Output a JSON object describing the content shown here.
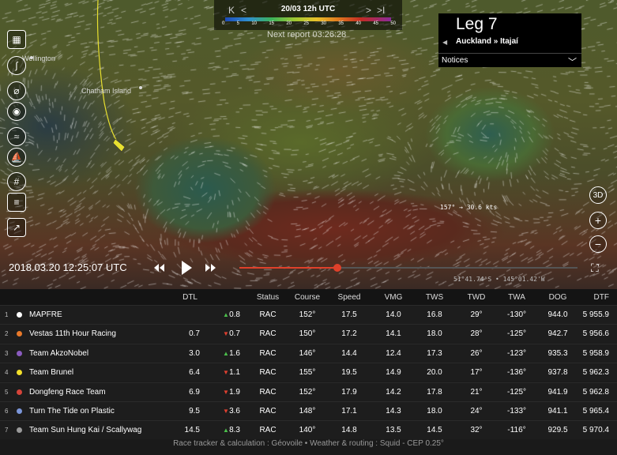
{
  "header": {
    "date": "20/03 12h UTC",
    "nav_first": "K",
    "nav_prev": "<",
    "nav_next": ">",
    "nav_last": ">I",
    "scale_labels": [
      "0",
      "5",
      "10",
      "15",
      "20",
      "25",
      "30",
      "35",
      "40",
      "45",
      "50"
    ],
    "next_report": "Next report 03:26:28"
  },
  "leg": {
    "title": "Leg 7",
    "route": "Auckland » Itajaí",
    "notices_label": "Notices"
  },
  "map": {
    "places": [
      "Wellington",
      "Chatham Island"
    ],
    "wind_readout": "157° → 30.6 kts",
    "coordinates": "51°41.74'S • 145°01.42'W",
    "boat_color": "#e8e030"
  },
  "playback": {
    "time": "2018.03.20 12:25:07 UTC",
    "progress": 0.29
  },
  "table": {
    "headers": [
      "DTL",
      "Status",
      "Course",
      "Speed",
      "VMG",
      "TWS",
      "TWD",
      "TWA",
      "DOG",
      "DTF"
    ],
    "rows": [
      {
        "rank": "1",
        "color": "#ffffff",
        "team": "MAPFRE",
        "dtl": "",
        "trend": "up",
        "change": "0.8",
        "status": "RAC",
        "course": "152°",
        "speed": "17.5",
        "vmg": "14.0",
        "tws": "16.8",
        "twd": "29°",
        "twa": "-130°",
        "dog": "944.0",
        "dtf": "5 955.9"
      },
      {
        "rank": "2",
        "color": "#e8792a",
        "team": "Vestas 11th Hour Racing",
        "dtl": "0.7",
        "trend": "down",
        "change": "0.7",
        "status": "RAC",
        "course": "150°",
        "speed": "17.2",
        "vmg": "14.1",
        "tws": "18.0",
        "twd": "28°",
        "twa": "-125°",
        "dog": "942.7",
        "dtf": "5 956.6"
      },
      {
        "rank": "3",
        "color": "#8a5bbf",
        "team": "Team AkzoNobel",
        "dtl": "3.0",
        "trend": "up",
        "change": "1.6",
        "status": "RAC",
        "course": "146°",
        "speed": "14.4",
        "vmg": "12.4",
        "tws": "17.3",
        "twd": "26°",
        "twa": "-123°",
        "dog": "935.3",
        "dtf": "5 958.9"
      },
      {
        "rank": "4",
        "color": "#f2df2a",
        "team": "Team Brunel",
        "dtl": "6.4",
        "trend": "down",
        "change": "1.1",
        "status": "RAC",
        "course": "155°",
        "speed": "19.5",
        "vmg": "14.9",
        "tws": "20.0",
        "twd": "17°",
        "twa": "-136°",
        "dog": "937.8",
        "dtf": "5 962.3"
      },
      {
        "rank": "5",
        "color": "#d6443a",
        "team": "Dongfeng Race Team",
        "dtl": "6.9",
        "trend": "down",
        "change": "1.9",
        "status": "RAC",
        "course": "152°",
        "speed": "17.9",
        "vmg": "14.2",
        "tws": "17.8",
        "twd": "21°",
        "twa": "-125°",
        "dog": "941.9",
        "dtf": "5 962.8"
      },
      {
        "rank": "6",
        "color": "#7b96d9",
        "team": "Turn The Tide on Plastic",
        "dtl": "9.5",
        "trend": "down",
        "change": "3.6",
        "status": "RAC",
        "course": "148°",
        "speed": "17.1",
        "vmg": "14.3",
        "tws": "18.0",
        "twd": "24°",
        "twa": "-133°",
        "dog": "941.1",
        "dtf": "5 965.4"
      },
      {
        "rank": "7",
        "color": "#9a9a9a",
        "team": "Team Sun Hung Kai / Scallywag",
        "dtl": "14.5",
        "trend": "up",
        "change": "8.3",
        "status": "RAC",
        "course": "140°",
        "speed": "14.8",
        "vmg": "13.5",
        "tws": "14.5",
        "twd": "32°",
        "twa": "-116°",
        "dog": "929.5",
        "dtf": "5 970.4"
      }
    ],
    "footer": "Race tracker & calculation : Géovoile • Weather & routing : Squid - CEP 0.25°"
  }
}
